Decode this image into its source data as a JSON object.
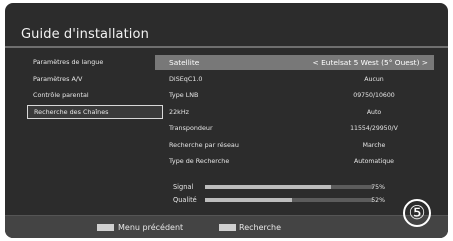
{
  "title": "Guide d'installation",
  "menu": [
    {
      "label": "Paramètres de langue",
      "selected": false
    },
    {
      "label": "Paramètres A/V",
      "selected": false
    },
    {
      "label": "Contrôle parental",
      "selected": false
    },
    {
      "label": "Recherche des Chaînes",
      "selected": true
    }
  ],
  "settings": [
    {
      "label": "Satellite",
      "value": "< Eutelsat 5 West (5° Ouest) >",
      "highlighted": true
    },
    {
      "label": "DiSEqC1.0",
      "value": "Aucun"
    },
    {
      "label": "Type LNB",
      "value": "09750/10600"
    },
    {
      "label": "22kHz",
      "value": "Auto"
    },
    {
      "label": "Transpondeur",
      "value": "11554/29950/V"
    },
    {
      "label": "Recherche par réseau",
      "value": "Marche"
    },
    {
      "label": "Type de Recherche",
      "value": "Automatique"
    }
  ],
  "signal": {
    "label": "Signal",
    "percent_text": "75%",
    "level": 0.75
  },
  "quality": {
    "label": "Qualité",
    "percent_text": "52%",
    "level": 0.52
  },
  "buttons": {
    "prev_label": "Menu précédent",
    "prev_key_color": "#d0d0d0",
    "search_label": "Recherche",
    "search_key_color": "#d0d0d0"
  },
  "step": "⑤"
}
